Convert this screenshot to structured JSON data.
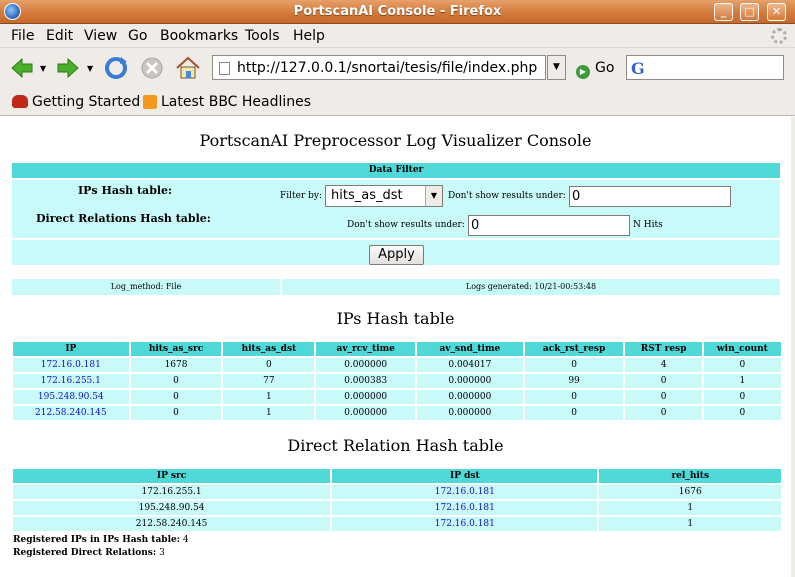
{
  "window": {
    "title": "PortscanAI Console - Firefox"
  },
  "menu": [
    "File",
    "Edit",
    "View",
    "Go",
    "Bookmarks",
    "Tools",
    "Help"
  ],
  "nav": {
    "url": "http://127.0.0.1/snortai/tesis/file/index.php",
    "go_label": "Go"
  },
  "bookmarks": [
    "Getting Started",
    "Latest BBC Headlines"
  ],
  "page": {
    "heading": "PortscanAI Preprocessor Log Visualizer Console",
    "filter": {
      "header": "Data Filter",
      "ips_label": "IPs Hash table:",
      "direct_label": "Direct Relations Hash table:",
      "filter_by_label": "Filter by:",
      "filter_by_value": "hits_as_dst",
      "dont_show_label": "Don't show results under:",
      "dont_show_value": "0",
      "dont_show_label2": "Don't show results under:",
      "dont_show_value2": "0",
      "n_hits_label": "N Hits",
      "apply_label": "Apply"
    },
    "log": {
      "method": "Log_method: File",
      "generated": "Logs generated: 10/21-00:53:48"
    },
    "ips_title": "IPs Hash table",
    "ips_table": {
      "headers": [
        "IP",
        "hits_as_src",
        "hits_as_dst",
        "av_rcv_time",
        "av_snd_time",
        "ack_rst_resp",
        "RST resp",
        "win_count"
      ],
      "rows": [
        [
          "172.16.0.181",
          "1678",
          "0",
          "0.000000",
          "0.004017",
          "0",
          "4",
          "0"
        ],
        [
          "172.16.255.1",
          "0",
          "77",
          "0.000383",
          "0.000000",
          "99",
          "0",
          "1"
        ],
        [
          "195.248.90.54",
          "0",
          "1",
          "0.000000",
          "0.000000",
          "0",
          "0",
          "0"
        ],
        [
          "212.58.240.145",
          "0",
          "1",
          "0.000000",
          "0.000000",
          "0",
          "0",
          "0"
        ]
      ]
    },
    "rel_title": "Direct Relation Hash table",
    "rel_table": {
      "headers": [
        "IP src",
        "IP dst",
        "rel_hits"
      ],
      "rows": [
        [
          "172.16.255.1",
          "172.16.0.181",
          "1676"
        ],
        [
          "195.248.90.54",
          "172.16.0.181",
          "1"
        ],
        [
          "212.58.240.145",
          "172.16.0.181",
          "1"
        ]
      ]
    },
    "footer": {
      "registered_ips_label": "Registered IPs in IPs Hash table:",
      "registered_ips_value": "4",
      "registered_rel_label": "Registered Direct Relations:",
      "registered_rel_value": "3"
    }
  },
  "colors": {
    "header_cyan": "#4fd8d8",
    "cell_cyan": "#c8fafa",
    "link_blue": "#1010c0",
    "titlebar": "#d47a3a"
  }
}
